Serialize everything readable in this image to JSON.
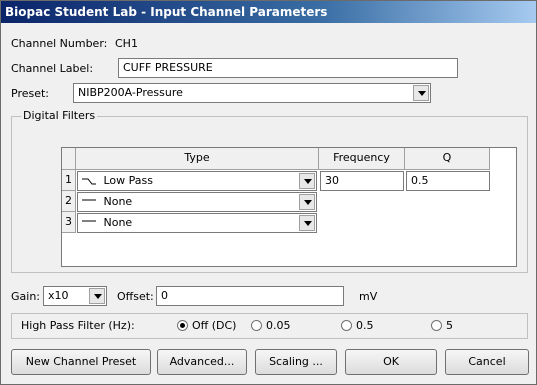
{
  "window": {
    "title": "Biopac Student Lab - Input Channel Parameters"
  },
  "channel": {
    "number_label": "Channel Number:",
    "number_value": "CH1"
  },
  "label": {
    "caption": "Channel Label:",
    "value": "CUFF PRESSURE"
  },
  "preset": {
    "caption": "Preset:",
    "value": "NIBP200A-Pressure"
  },
  "digital_filters": {
    "title": "Digital Filters",
    "headers": {
      "type": "Type",
      "frequency": "Frequency",
      "q": "Q"
    },
    "rows": [
      {
        "num": "1",
        "type": "Low Pass",
        "icon": "low-pass-icon",
        "frequency": "30",
        "q": "0.5"
      },
      {
        "num": "2",
        "type": "None",
        "icon": "none-filter-icon"
      },
      {
        "num": "3",
        "type": "None",
        "icon": "none-filter-icon"
      }
    ]
  },
  "gain": {
    "caption": "Gain:",
    "value": "x10"
  },
  "offset": {
    "caption": "Offset:",
    "value": "0",
    "unit": "mV"
  },
  "high_pass": {
    "caption": "High Pass Filter (Hz):",
    "options": [
      {
        "label": "Off (DC)",
        "selected": true
      },
      {
        "label": "0.05",
        "selected": false
      },
      {
        "label": "0.5",
        "selected": false
      },
      {
        "label": "5",
        "selected": false
      }
    ]
  },
  "buttons": {
    "new_preset": "New Channel Preset",
    "advanced": "Advanced...",
    "scaling": "Scaling ...",
    "ok": "OK",
    "cancel": "Cancel"
  }
}
